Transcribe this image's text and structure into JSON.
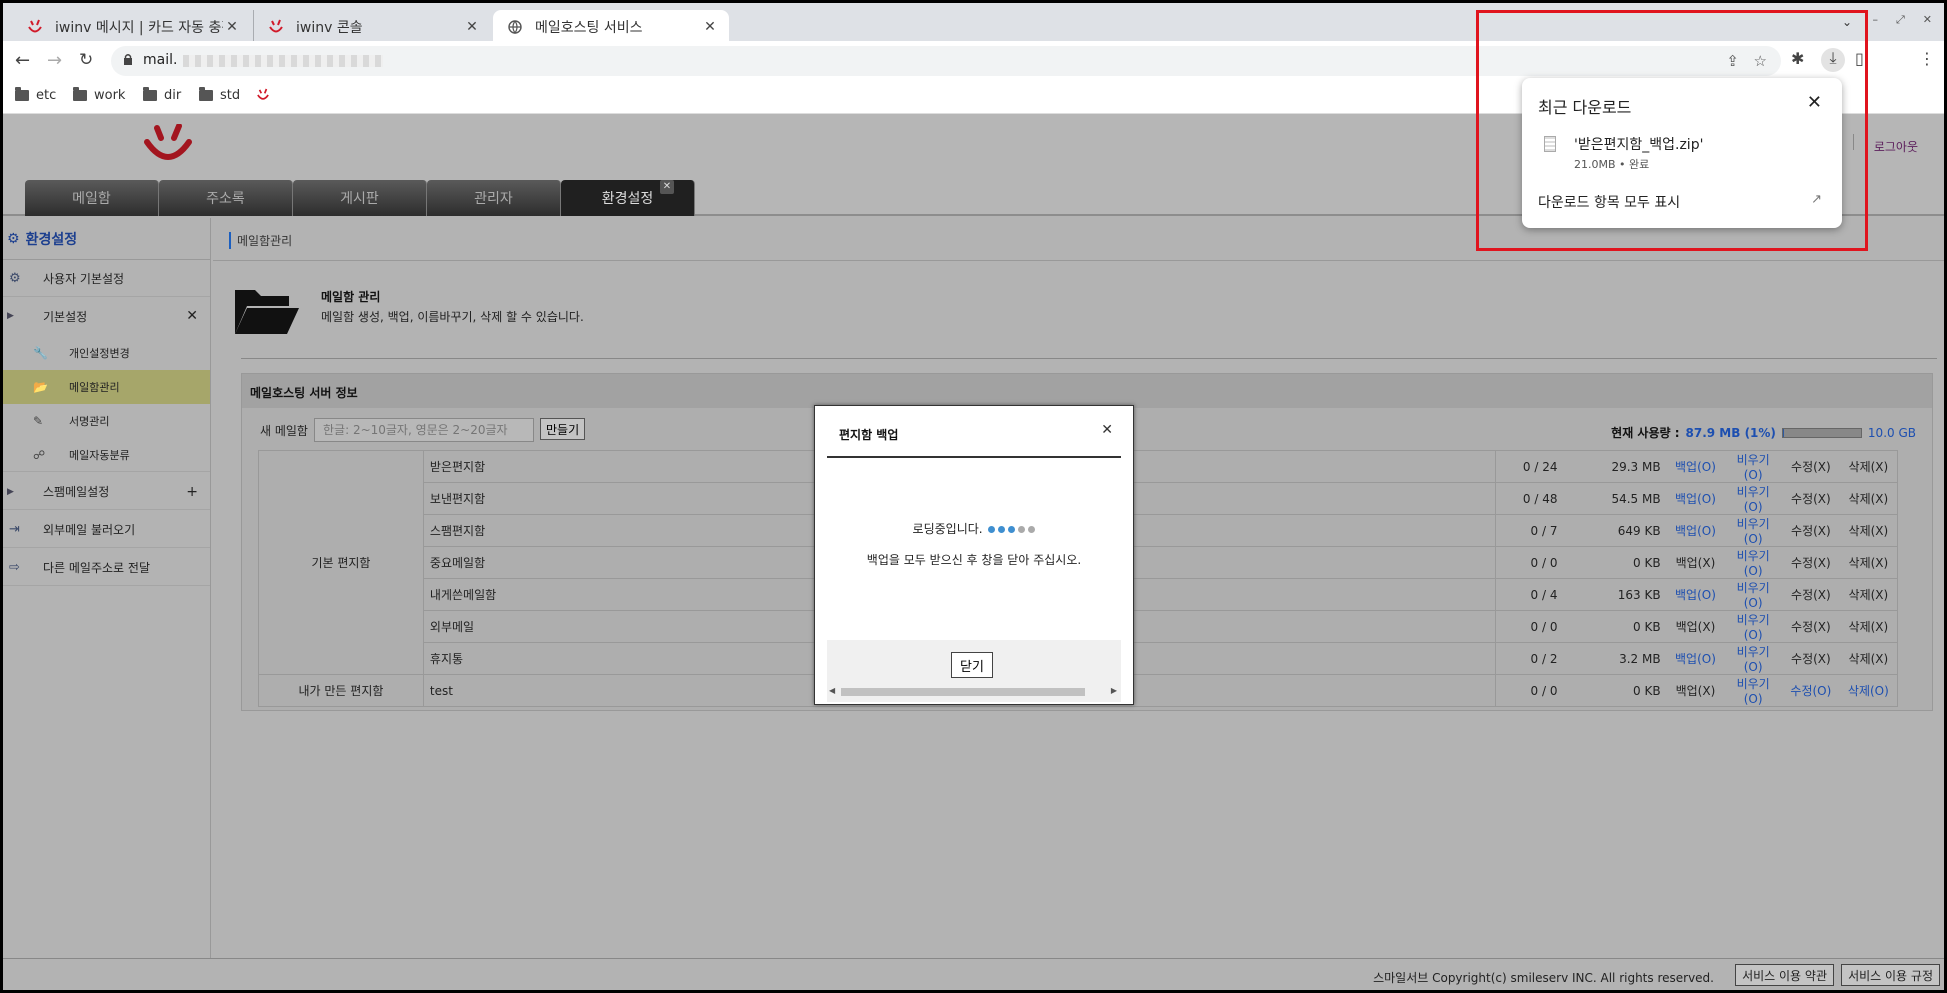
{
  "browser": {
    "tabs": [
      {
        "label": "iwinv 메시지 | 카드 자동 충전 최",
        "active": false
      },
      {
        "label": "iwinv 콘솔",
        "active": false
      },
      {
        "label": "메일호스팅 서비스",
        "active": true
      }
    ],
    "url": "mail.",
    "bookmarks": [
      "etc",
      "work",
      "dir",
      "std"
    ]
  },
  "downloads": {
    "title": "최근 다운로드",
    "file_name": "'받은편지함_백업.zip'",
    "file_meta": "21.0MB • 완료",
    "show_all": "다운로드 항목 모두 표시"
  },
  "header": {
    "logout": "로그아웃",
    "tabs": [
      "메일함",
      "주소록",
      "게시판",
      "관리자",
      "환경설정"
    ],
    "active_tab": "환경설정"
  },
  "sidebar": {
    "title": "환경설정",
    "items": {
      "user_basic": "사용자 기본설정",
      "basic": "기본설정",
      "personal": "개인설정변경",
      "mailbox_mgmt": "메일함관리",
      "signature": "서명관리",
      "auto_sort": "메일자동분류",
      "spam": "스팸메일설정",
      "external": "외부메일 불러오기",
      "forward": "다른 메일주소로 전달"
    }
  },
  "content": {
    "breadcrumb": "메일함관리",
    "section_title": "메일함 관리",
    "section_desc": "메일함 생성, 백업, 이름바꾸기, 삭제 할 수 있습니다.",
    "panel_title": "메일호스팅 서버 정보",
    "new_box_label": "새 메일함",
    "new_box_placeholder": "한글: 2~10글자, 영문은 2~20글자",
    "create_button": "만들기",
    "usage_label": "현재 사용량 :",
    "usage_value": "87.9 MB (1%)",
    "usage_percent": 1,
    "usage_total": "10.0 GB",
    "groups": {
      "basic": "기본 편지함",
      "custom": "내가 만든 편지함"
    },
    "rows": [
      {
        "name": "받은편지함",
        "count": "0 / 24",
        "size": "29.3 MB",
        "backup": "백업(O)",
        "empty": "비우기(O)",
        "edit": "수정(X)",
        "del": "삭제(X)",
        "backup_on": true,
        "edit_on": false,
        "del_on": false
      },
      {
        "name": "보낸편지함",
        "count": "0 / 48",
        "size": "54.5 MB",
        "backup": "백업(O)",
        "empty": "비우기(O)",
        "edit": "수정(X)",
        "del": "삭제(X)",
        "backup_on": true,
        "edit_on": false,
        "del_on": false
      },
      {
        "name": "스팸편지함",
        "count": "0 / 7",
        "size": "649 KB",
        "backup": "백업(O)",
        "empty": "비우기(O)",
        "edit": "수정(X)",
        "del": "삭제(X)",
        "backup_on": true,
        "edit_on": false,
        "del_on": false
      },
      {
        "name": "중요메일함",
        "count": "0 / 0",
        "size": "0 KB",
        "backup": "백업(X)",
        "empty": "비우기(O)",
        "edit": "수정(X)",
        "del": "삭제(X)",
        "backup_on": false,
        "edit_on": false,
        "del_on": false
      },
      {
        "name": "내게쓴메일함",
        "count": "0 / 4",
        "size": "163 KB",
        "backup": "백업(O)",
        "empty": "비우기(O)",
        "edit": "수정(X)",
        "del": "삭제(X)",
        "backup_on": true,
        "edit_on": false,
        "del_on": false
      },
      {
        "name": "외부메일",
        "count": "0 / 0",
        "size": "0 KB",
        "backup": "백업(X)",
        "empty": "비우기(O)",
        "edit": "수정(X)",
        "del": "삭제(X)",
        "backup_on": false,
        "edit_on": false,
        "del_on": false
      },
      {
        "name": "휴지통",
        "count": "0 / 2",
        "size": "3.2 MB",
        "backup": "백업(O)",
        "empty": "비우기(O)",
        "edit": "수정(X)",
        "del": "삭제(X)",
        "backup_on": true,
        "edit_on": false,
        "del_on": false
      },
      {
        "name": "test",
        "count": "0 / 0",
        "size": "0 KB",
        "backup": "백업(X)",
        "empty": "비우기(O)",
        "edit": "수정(O)",
        "del": "삭제(O)",
        "backup_on": false,
        "edit_on": true,
        "del_on": true
      }
    ]
  },
  "modal": {
    "title": "편지함 백업",
    "loading": "로딩중입니다.",
    "message": "백업을 모두 받으신 후 창을 닫아 주십시오.",
    "close_button": "닫기"
  },
  "footer": {
    "copyright": "스마일서브 Copyright(c) smileserv INC. All rights reserved.",
    "terms": "서비스 이용 약관",
    "rules": "서비스 이용 규정"
  },
  "colors": {
    "link": "#1d4fb0",
    "highlight": "#e0141e",
    "brand": "#d11a2a"
  }
}
